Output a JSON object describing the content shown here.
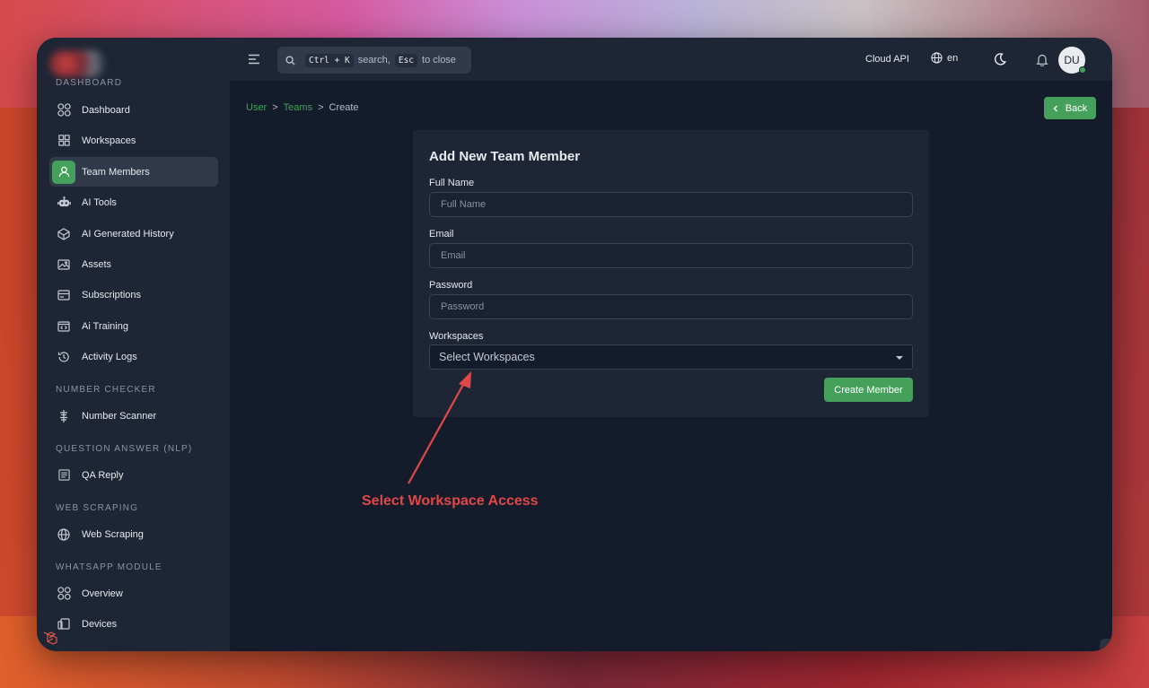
{
  "sidebar": {
    "sections": {
      "dashboard": "DASHBOARD",
      "number_checker": "NUMBER CHECKER",
      "question_answer": "QUESTION ANSWER (NLP)",
      "web_scraping": "WEB SCRAPING",
      "whatsapp_module": "WHATSAPP MODULE"
    },
    "items": [
      {
        "label": "Dashboard",
        "icon": "dashboard-icon"
      },
      {
        "label": "Workspaces",
        "icon": "grid-icon"
      },
      {
        "label": "Team Members",
        "icon": "user-icon",
        "active": true
      },
      {
        "label": "AI Tools",
        "icon": "robot-icon"
      },
      {
        "label": "AI Generated History",
        "icon": "cube-icon"
      },
      {
        "label": "Assets",
        "icon": "image-icon"
      },
      {
        "label": "Subscriptions",
        "icon": "card-icon"
      },
      {
        "label": "Ai Training",
        "icon": "code-icon"
      },
      {
        "label": "Activity Logs",
        "icon": "history-icon"
      },
      {
        "label": "Number Scanner",
        "icon": "scanner-icon"
      },
      {
        "label": "QA Reply",
        "icon": "document-icon"
      },
      {
        "label": "Web Scraping",
        "icon": "globe-icon"
      },
      {
        "label": "Overview",
        "icon": "dashboard-icon"
      },
      {
        "label": "Devices",
        "icon": "devices-icon"
      }
    ]
  },
  "topbar": {
    "search": {
      "key1": "Ctrl + K",
      "text1": "search,",
      "key2": "Esc",
      "text2": "to close"
    },
    "cloud_api": "Cloud API",
    "language": "en",
    "avatar_initials": "DU"
  },
  "breadcrumb": {
    "user": "User",
    "teams": "Teams",
    "current": "Create",
    "separator": ">"
  },
  "back_button": "Back",
  "form": {
    "title": "Add New Team Member",
    "full_name": {
      "label": "Full Name",
      "placeholder": "Full Name"
    },
    "email": {
      "label": "Email",
      "placeholder": "Email"
    },
    "password": {
      "label": "Password",
      "placeholder": "Password"
    },
    "workspaces": {
      "label": "Workspaces",
      "value": "Select Workspaces"
    },
    "submit": "Create Member"
  },
  "annotation": {
    "text": "Select Workspace Access",
    "color": "#e04848"
  },
  "colors": {
    "accent": "#45a05c",
    "sidebar": "#1e2635",
    "content": "#141b2b"
  }
}
